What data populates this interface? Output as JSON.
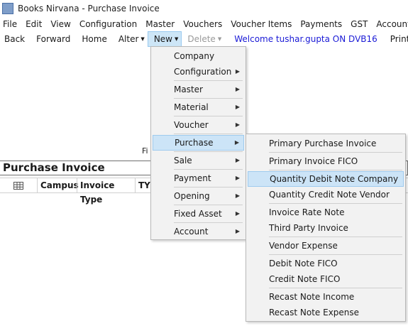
{
  "window": {
    "title": "Books Nirvana - Purchase Invoice"
  },
  "menubar": [
    "File",
    "Edit",
    "View",
    "Configuration",
    "Master",
    "Vouchers",
    "Voucher Items",
    "Payments",
    "GST",
    "Accounts"
  ],
  "toolbar": {
    "back": "Back",
    "forward": "Forward",
    "home": "Home",
    "alter": "Alter",
    "new": "New",
    "delete": "Delete",
    "welcome": "Welcome tushar.gupta ON DVB16",
    "print": "Print"
  },
  "page": {
    "fi_label": "Fi",
    "title": "Purchase Invoice",
    "columns": [
      "Campus",
      "Invoice Type",
      "TY"
    ]
  },
  "new_menu": {
    "items": [
      "Company",
      "Configuration",
      "Master",
      "Material",
      "Voucher",
      "Purchase",
      "Sale",
      "Payment",
      "Opening",
      "Fixed Asset",
      "Account"
    ],
    "highlighted": "Purchase"
  },
  "purchase_menu": {
    "items": [
      "Primary Purchase Invoice",
      "Primary Invoice FICO",
      "Quantity Debit Note Company",
      "Quantity Credit Note Vendor",
      "Invoice Rate Note",
      "Third Party Invoice",
      "Vendor Expense",
      "Debit Note FICO",
      "Credit Note FICO",
      "Recast Note Income",
      "Recast Note Expense"
    ],
    "highlighted": "Quantity Debit Note Company"
  },
  "colors": {
    "highlight": "#cce4f7",
    "welcome": "#1a1ad6",
    "menu_bg": "#f2f2f2"
  }
}
